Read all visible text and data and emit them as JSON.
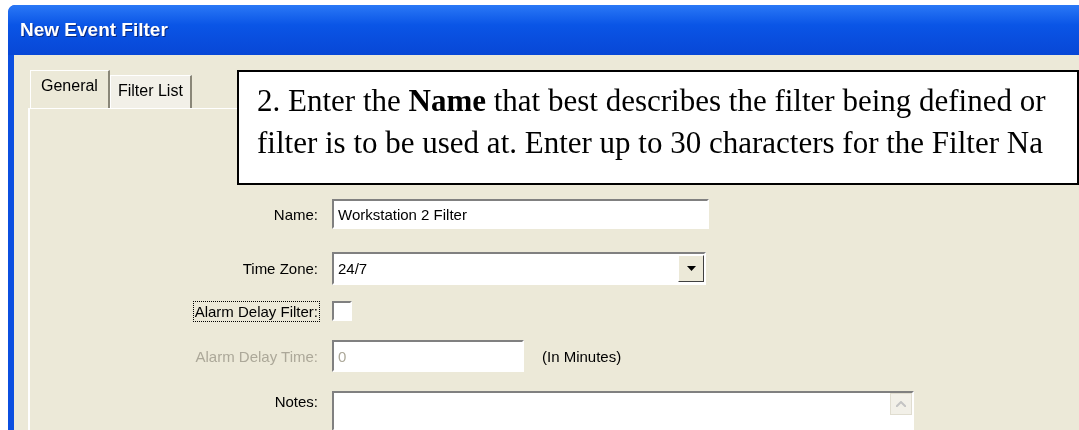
{
  "window": {
    "title": "New Event Filter"
  },
  "tabs": [
    {
      "label": "General",
      "selected": true
    },
    {
      "label": "Filter List",
      "selected": false
    }
  ],
  "callout": {
    "lines": [
      "2. Enter the **Name** that best describes the filter being defined or",
      "filter is to be used at. Enter up to 30 characters for the Filter Na"
    ]
  },
  "fields": [
    {
      "kind": "text",
      "label": "Name:",
      "value": "Workstation 2 Filter",
      "disabled": false,
      "focused": false
    },
    {
      "kind": "dropdown",
      "label": "Time Zone:",
      "value": "24/7",
      "disabled": false,
      "focused": false
    },
    {
      "kind": "checkbox",
      "label": "Alarm Delay Filter:",
      "checked": false,
      "disabled": false,
      "focused": true
    },
    {
      "kind": "text",
      "label": "Alarm Delay Time:",
      "value": "0",
      "suffix": "(In Minutes)",
      "disabled": true,
      "focused": false
    },
    {
      "kind": "textarea",
      "label": "Notes:",
      "disabled": false,
      "focused": false
    }
  ]
}
